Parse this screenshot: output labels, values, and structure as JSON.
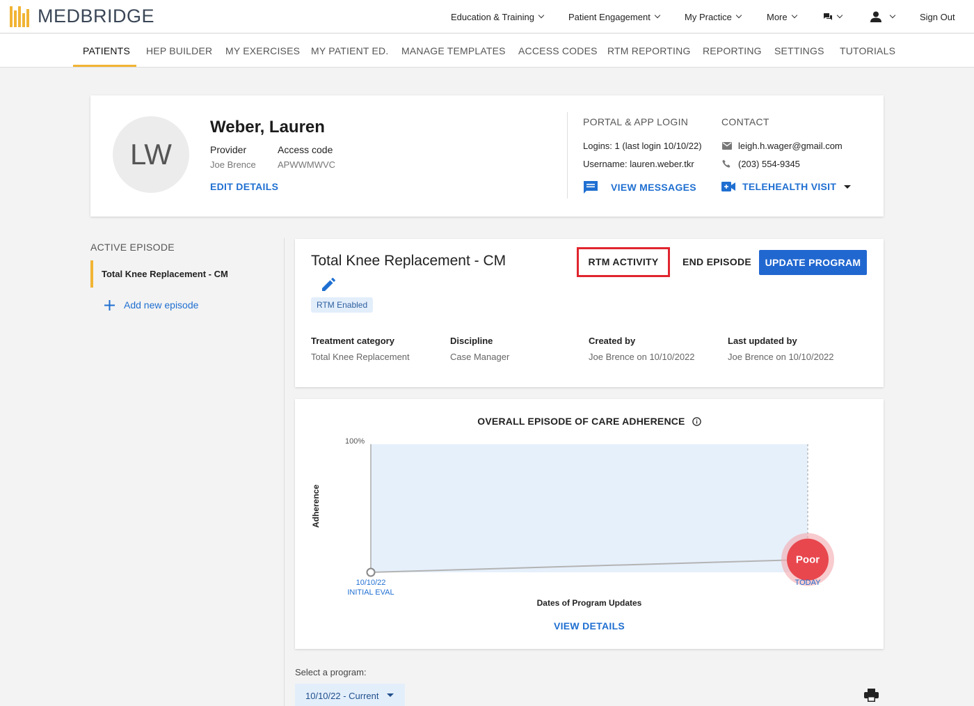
{
  "brand": {
    "name": "MEDBRIDGE"
  },
  "topnav": {
    "education": "Education & Training",
    "engagement": "Patient Engagement",
    "practice": "My Practice",
    "more": "More",
    "signout": "Sign Out"
  },
  "subnav": {
    "tabs": [
      "PATIENTS",
      "HEP BUILDER",
      "MY EXERCISES",
      "MY PATIENT ED.",
      "MANAGE TEMPLATES",
      "ACCESS CODES",
      "RTM REPORTING",
      "REPORTING",
      "SETTINGS",
      "TUTORIALS"
    ],
    "active": "PATIENTS"
  },
  "patient": {
    "initials": "LW",
    "name": "Weber, Lauren",
    "provider_label": "Provider",
    "provider": "Joe Brence",
    "access_label": "Access code",
    "access_code": "APWWMWVC",
    "edit": "EDIT DETAILS",
    "portal_header": "PORTAL & APP LOGIN",
    "logins": "Logins: 1 (last login 10/10/22)",
    "username": "Username: lauren.weber.tkr",
    "view_messages": "VIEW MESSAGES",
    "contact_header": "CONTACT",
    "email": "leigh.h.wager@gmail.com",
    "phone": "(203) 554-9345",
    "telehealth": "TELEHEALTH VISIT"
  },
  "sidebar": {
    "title": "ACTIVE EPISODE",
    "episode": "Total Knee Replacement - CM",
    "add": "Add new episode"
  },
  "episode": {
    "title": "Total Knee Replacement - CM",
    "badge": "RTM Enabled",
    "rtm_activity": "RTM ACTIVITY",
    "end_episode": "END EPISODE",
    "update_program": "UPDATE PROGRAM",
    "meta": [
      {
        "label": "Treatment category",
        "value": "Total Knee Replacement"
      },
      {
        "label": "Discipline",
        "value": "Case Manager"
      },
      {
        "label": "Created by",
        "value": "Joe Brence on 10/10/2022"
      },
      {
        "label": "Last updated by",
        "value": "Joe Brence on 10/10/2022"
      }
    ]
  },
  "adherence": {
    "title": "OVERALL EPISODE OF CARE ADHERENCE",
    "y_max_label": "100%",
    "y_axis": "Adherence",
    "x_axis": "Dates of Program Updates",
    "start_date": "10/10/22",
    "start_label": "INITIAL EVAL",
    "end_label": "TODAY",
    "status": "Poor",
    "view_details": "VIEW DETAILS"
  },
  "chart_data": {
    "type": "line",
    "x": [
      "10/10/22",
      "TODAY"
    ],
    "series": [
      {
        "values": [
          0,
          10
        ]
      }
    ],
    "ylim": [
      0,
      100
    ],
    "xlabel": "Dates of Program Updates",
    "ylabel": "Adherence"
  },
  "program": {
    "label": "Select a program:",
    "selected": "10/10/22 - Current"
  },
  "colors": {
    "accent": "#f1b434",
    "primary": "#2167d0",
    "highlight": "#e0252e",
    "poor": "#e8474e"
  }
}
